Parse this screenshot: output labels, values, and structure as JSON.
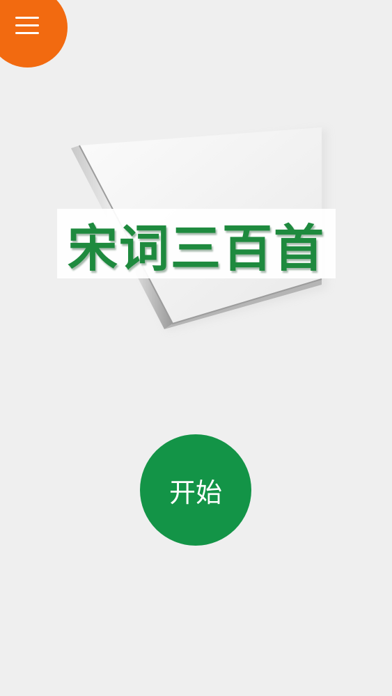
{
  "app": {
    "title": "宋词三百首"
  },
  "menu": {
    "icon": "hamburger-menu-icon",
    "color": "#f26a10"
  },
  "hero": {
    "title": "宋词三百首",
    "title_color": "#1e8a3e"
  },
  "start_button": {
    "label": "开始",
    "color": "#139447"
  }
}
